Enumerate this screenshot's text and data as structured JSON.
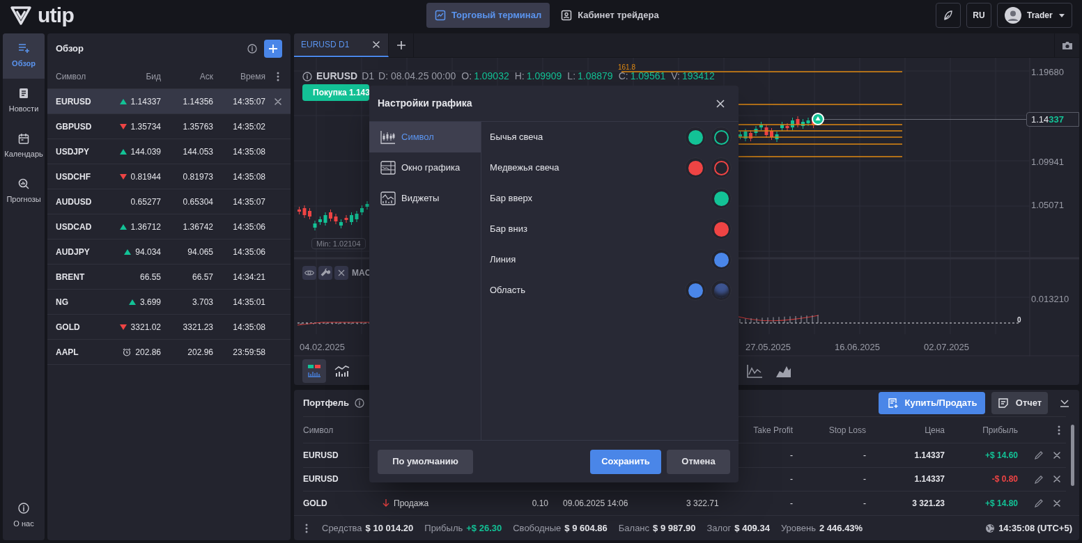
{
  "header": {
    "logo": "utip",
    "tabs": [
      {
        "label": "Торговый терминал",
        "selected": true
      },
      {
        "label": "Кабинет трейдера",
        "selected": false
      }
    ],
    "language": "RU",
    "user": "Trader"
  },
  "nav": {
    "items": [
      {
        "label": "Обзор",
        "selected": true
      },
      {
        "label": "Новости",
        "selected": false
      },
      {
        "label": "Календарь",
        "selected": false
      },
      {
        "label": "Прогнозы",
        "selected": false
      }
    ],
    "footer": "О нас"
  },
  "watchlist": {
    "title": "Обзор",
    "columns": [
      "Символ",
      "Бид",
      "Аск",
      "Время"
    ],
    "rows": [
      {
        "symbol": "EURUSD",
        "kind": "up",
        "bid": "1.14337",
        "ask": "1.14356",
        "time": "14:35:07",
        "selected": true
      },
      {
        "symbol": "GBPUSD",
        "kind": "down",
        "bid": "1.35734",
        "ask": "1.35763",
        "time": "14:35:02",
        "selected": false
      },
      {
        "symbol": "USDJPY",
        "kind": "up",
        "bid": "144.039",
        "ask": "144.053",
        "time": "14:35:08",
        "selected": false
      },
      {
        "symbol": "USDCHF",
        "kind": "down",
        "bid": "0.81944",
        "ask": "0.81973",
        "time": "14:35:08",
        "selected": false
      },
      {
        "symbol": "AUDUSD",
        "kind": "plain",
        "bid": "0.65277",
        "ask": "0.65304",
        "time": "14:35:07",
        "selected": false
      },
      {
        "symbol": "USDCAD",
        "kind": "up",
        "bid": "1.36712",
        "ask": "1.36742",
        "time": "14:35:06",
        "selected": false
      },
      {
        "symbol": "AUDJPY",
        "kind": "up",
        "bid": "94.034",
        "ask": "94.065",
        "time": "14:35:06",
        "selected": false
      },
      {
        "symbol": "BRENT",
        "kind": "plain",
        "bid": "66.55",
        "ask": "66.57",
        "time": "14:34:21",
        "selected": false
      },
      {
        "symbol": "NG",
        "kind": "up",
        "bid": "3.699",
        "ask": "3.703",
        "time": "14:35:01",
        "selected": false
      },
      {
        "symbol": "GOLD",
        "kind": "down",
        "bid": "3321.02",
        "ask": "3321.23",
        "time": "14:35:08",
        "selected": false
      },
      {
        "symbol": "AAPL",
        "kind": "alarm",
        "bid": "202.86",
        "ask": "202.96",
        "time": "23:59:58",
        "selected": false
      }
    ]
  },
  "chart": {
    "tabs": [
      {
        "label": "EURUSD D1",
        "selected": true
      }
    ],
    "symbol": "EURUSD",
    "timeframe": "D1",
    "date": "D: 08.04.25 00:00",
    "ohlcv": [
      {
        "label": "O:",
        "value": "1.09032"
      },
      {
        "label": "H:",
        "value": "1.09909"
      },
      {
        "label": "L:",
        "value": "1.08879"
      },
      {
        "label": "C:",
        "value": "1.09561"
      },
      {
        "label": "V:",
        "value": "193412"
      }
    ],
    "buy_button": "Покупка 1.143",
    "fib_label": "161.8",
    "price_axis": [
      "1.19680",
      "1.09941",
      "1.05071"
    ],
    "current_price": "1.14**337**",
    "min_label": "Min: 1.02104",
    "indicator": "MAC",
    "indicator_axis": "0.013210",
    "indicator_zero": "0",
    "dates": [
      "04.02.2025",
      "27.05.2025",
      "16.06.2025",
      "02.07.2025"
    ]
  },
  "dialog": {
    "title": "Настройки графика",
    "menu": [
      {
        "label": "Символ",
        "selected": true
      },
      {
        "label": "Окно графика",
        "selected": false
      },
      {
        "label": "Виджеты",
        "selected": false
      }
    ],
    "settings": [
      {
        "label": "Бычья свеча",
        "swatches": [
          {
            "kind": "filled",
            "color": "#13c296"
          },
          {
            "kind": "outline",
            "color": "#13c296"
          }
        ]
      },
      {
        "label": "Медвежья свеча",
        "swatches": [
          {
            "kind": "filled",
            "color": "#ef4444"
          },
          {
            "kind": "outline",
            "color": "#ef4444"
          }
        ]
      },
      {
        "label": "Бар вверх",
        "swatches": [
          {
            "kind": "filled",
            "color": "#13c296"
          }
        ]
      },
      {
        "label": "Бар вниз",
        "swatches": [
          {
            "kind": "filled",
            "color": "#ef4444"
          }
        ]
      },
      {
        "label": "Линия",
        "swatches": [
          {
            "kind": "filled",
            "color": "#4a86e8"
          }
        ]
      },
      {
        "label": "Область",
        "swatches": [
          {
            "kind": "filled",
            "color": "#4a86e8"
          },
          {
            "kind": "gradient",
            "color": "#3d5490"
          }
        ]
      }
    ],
    "buttons": {
      "reset": "По умолчанию",
      "save": "Сохранить",
      "cancel": "Отмена"
    }
  },
  "portfolio": {
    "title": "Портфель",
    "trade_button": "Купить/Продать",
    "report_button": "Отчет",
    "columns": {
      "symbol": "Символ",
      "take_profit": "Take Profit",
      "stop_loss": "Stop Loss",
      "price": "Цена",
      "profit": "Прибыль"
    },
    "rows": [
      {
        "symbol": "EURUSD",
        "take_profit": "-",
        "stop_loss": "-",
        "price": "1.14337",
        "profit": "+$ 14.60",
        "profit_positive": true
      },
      {
        "symbol": "EURUSD",
        "take_profit": "-",
        "stop_loss": "-",
        "price": "1.14337",
        "profit": "-$ 0.80",
        "profit_positive": false
      },
      {
        "symbol": "GOLD",
        "column_2": {
          "text": "Продажа",
          "kind": "down"
        },
        "column_3": "0.10",
        "column_4": "09.06.2025 14:06",
        "column_5": "3 322.71",
        "take_profit": "-",
        "stop_loss": "-",
        "price": "3 321.23",
        "profit": "+$ 14.80",
        "profit_positive": true
      }
    ]
  },
  "status_bar": {
    "items": [
      {
        "label": "Средства",
        "value": "$ 10 014.20",
        "positive": false
      },
      {
        "label": "Прибыль",
        "value": "+$ 26.30",
        "positive": true
      },
      {
        "label": "Свободные",
        "value": "$ 9 604.86",
        "positive": false
      },
      {
        "label": "Баланс",
        "value": "$ 9 987.90",
        "positive": false
      },
      {
        "label": "Залог",
        "value": "$ 409.34",
        "positive": false
      },
      {
        "label": "Уровень",
        "value": "2 446.43%",
        "positive": false
      }
    ],
    "time": "14:35:08 (UTC+5)"
  }
}
